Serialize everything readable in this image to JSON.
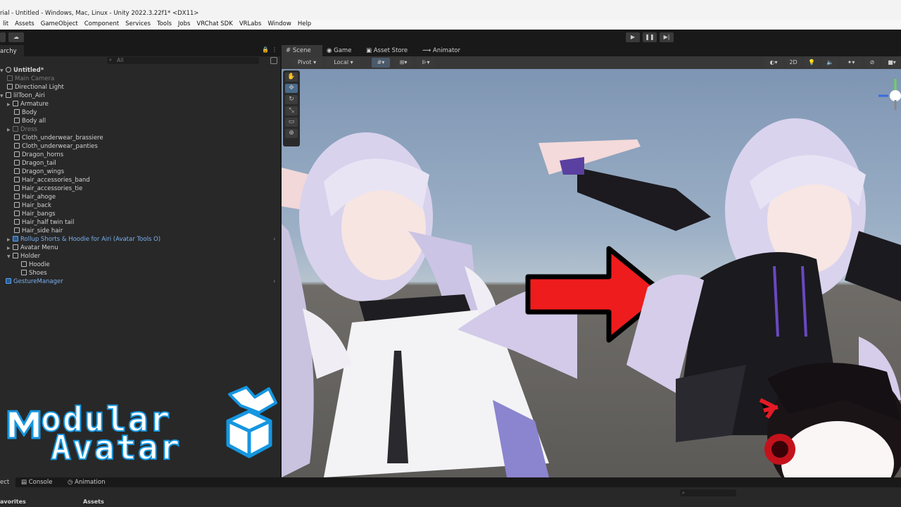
{
  "window": {
    "title": "rial - Untitled - Windows, Mac, Linux - Unity 2022.3.22f1* <DX11>"
  },
  "menu": [
    "lit",
    "Assets",
    "GameObject",
    "Component",
    "Services",
    "Tools",
    "Jobs",
    "VRChat SDK",
    "VRLabs",
    "Window",
    "Help"
  ],
  "toolbar": {
    "play_icon": "play-icon",
    "pause_icon": "pause-icon",
    "step_icon": "step-icon"
  },
  "hierarchy": {
    "tab_label": "archy",
    "search_placeholder": "All",
    "scene_name": "Untitled*",
    "items": [
      {
        "label": "Main Camera",
        "style": "dis"
      },
      {
        "label": "Directional Light",
        "style": ""
      },
      {
        "label": "lilToon_Airi",
        "style": ""
      },
      {
        "label": "Armature",
        "style": ""
      },
      {
        "label": "Body",
        "style": ""
      },
      {
        "label": "Body all",
        "style": ""
      },
      {
        "label": "Dress",
        "style": "dis"
      },
      {
        "label": "Cloth_underwear_brassiere",
        "style": ""
      },
      {
        "label": "Cloth_underwear_panties",
        "style": ""
      },
      {
        "label": "Dragon_horns",
        "style": ""
      },
      {
        "label": "Dragon_tail",
        "style": ""
      },
      {
        "label": "Dragon_wings",
        "style": ""
      },
      {
        "label": "Hair_accessories_band",
        "style": ""
      },
      {
        "label": "Hair_accessories_tie",
        "style": ""
      },
      {
        "label": "Hair_ahoge",
        "style": ""
      },
      {
        "label": "Hair_back",
        "style": ""
      },
      {
        "label": "Hair_bangs",
        "style": ""
      },
      {
        "label": "Hair_half twin tail",
        "style": ""
      },
      {
        "label": "Hair_side hair",
        "style": ""
      },
      {
        "label": "Rollup Shorts & Hoodie for Airi (Avatar Tools O)",
        "style": "blue"
      },
      {
        "label": "Avatar Menu",
        "style": ""
      },
      {
        "label": "Holder",
        "style": ""
      },
      {
        "label": "Hoodie",
        "style": ""
      },
      {
        "label": "Shoes",
        "style": ""
      },
      {
        "label": "GestureManager",
        "style": "blue"
      }
    ]
  },
  "scene": {
    "tabs": [
      "Scene",
      "Game",
      "Asset Store",
      "Animator"
    ],
    "pivot": "Pivot",
    "local": "Local",
    "mode_2d": "2D"
  },
  "bottom": {
    "tabs": [
      "ect",
      "Console",
      "Animation"
    ],
    "favorites": "avorites",
    "assets": "Assets"
  },
  "logo": {
    "line1": "odular",
    "line2": "Avatar",
    "color": "#1596e0"
  }
}
